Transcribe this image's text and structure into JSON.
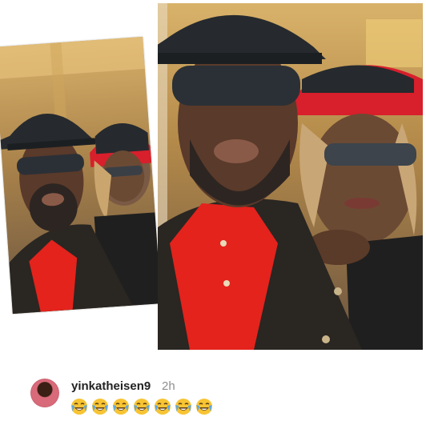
{
  "comment": {
    "username": "yinkatheisen9",
    "time": "2h",
    "emoji_count": 7,
    "emoji_icon": "face-with-tears-of-joy-icon"
  },
  "colors": {
    "shirt_red": "#e3231c",
    "hat_band_red": "#d81f2c",
    "jacket": "#2a2622",
    "hat": "#262a2e",
    "emoji_yellow": "#f7c433",
    "tear_blue": "#5aa7e6"
  }
}
